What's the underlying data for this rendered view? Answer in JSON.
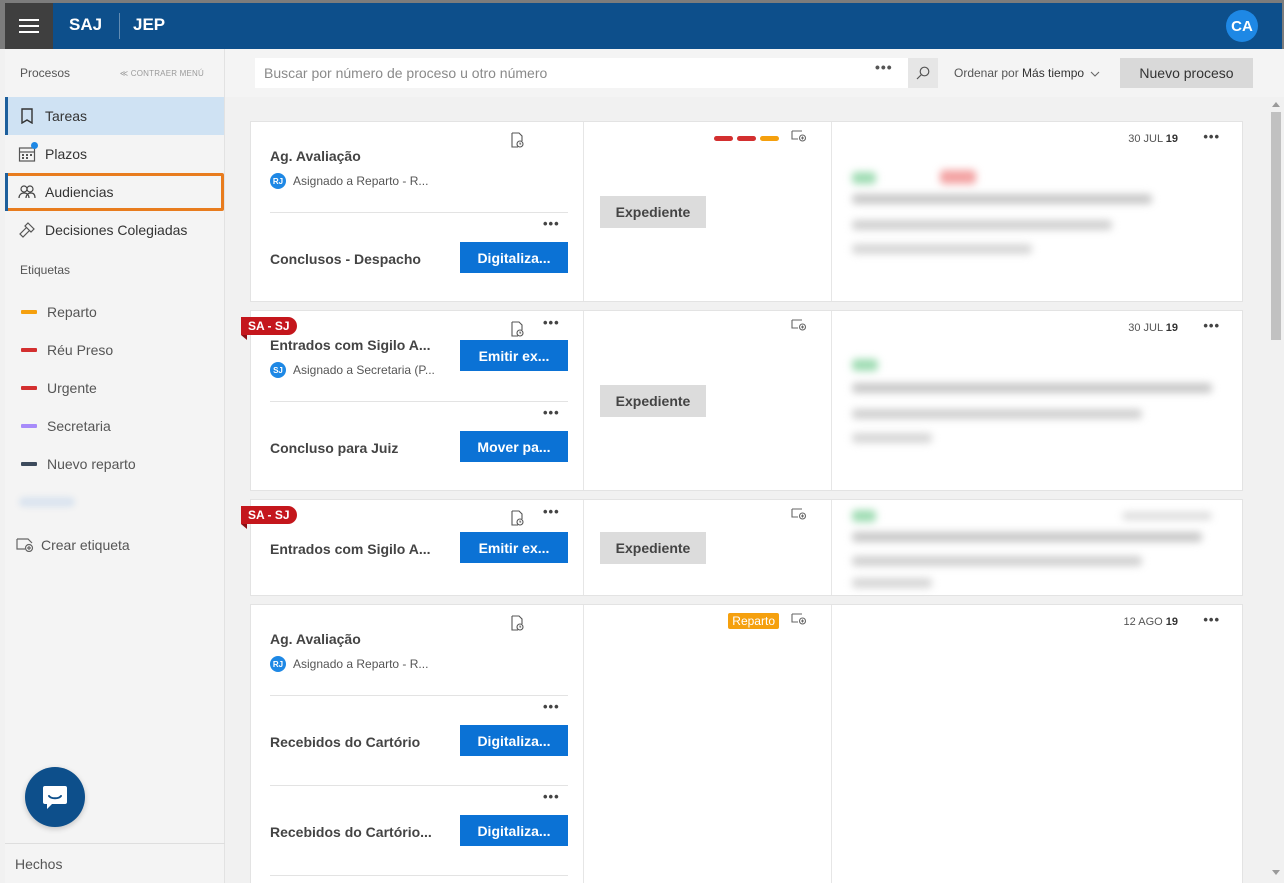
{
  "topbar": {
    "app1": "SAJ",
    "app2": "JEP",
    "avatar": "CA"
  },
  "sidebar": {
    "header_title": "Procesos",
    "collapse": "≪ CONTRAER MENÚ",
    "nav": [
      {
        "label": "Tareas",
        "icon": "bookmark-icon"
      },
      {
        "label": "Plazos",
        "icon": "calendar-icon"
      },
      {
        "label": "Audiencias",
        "icon": "people-icon"
      },
      {
        "label": "Decisiones Colegiadas",
        "icon": "gavel-icon"
      }
    ],
    "tags_title": "Etiquetas",
    "tags": [
      {
        "label": "Reparto",
        "color": "#f5a00e"
      },
      {
        "label": "Réu Preso",
        "color": "#d32f2f"
      },
      {
        "label": "Urgente",
        "color": "#d32f2f"
      },
      {
        "label": "Secretaria",
        "color": "#a78bfa"
      },
      {
        "label": "Nuevo reparto",
        "color": "#3c4a5c"
      }
    ],
    "create_tag": "Crear etiqueta",
    "footer": "Hechos"
  },
  "search": {
    "placeholder": "Buscar por número de proceso u otro número",
    "more": "•••",
    "sort_prefix": "Ordenar por",
    "sort_value": "Más tiempo",
    "new_process": "Nuevo proceso"
  },
  "cards": [
    {
      "task1_title": "Ag. Avaliação",
      "assign_initials": "RJ",
      "assign_text": "Asignado a Reparto - R...",
      "task2_title": "Conclusos - Despacho",
      "task2_button": "Digitaliza...",
      "expediente": "Expediente",
      "date_day": "30 JUL",
      "date_year": "19",
      "tag_colors": [
        "#d32f2f",
        "#d32f2f",
        "#f5a00e"
      ]
    },
    {
      "sa_tag": "SA - SJ",
      "task1_title": "Entrados com Sigilo A...",
      "task1_button": "Emitir ex...",
      "assign_initials": "SJ",
      "assign_text": "Asignado a Secretaria (P...",
      "task2_title": "Concluso para Juiz",
      "task2_button": "Mover pa...",
      "expediente": "Expediente",
      "date_day": "30 JUL",
      "date_year": "19"
    },
    {
      "sa_tag": "SA - SJ",
      "task1_title": "Entrados com Sigilo A...",
      "task1_button": "Emitir ex...",
      "expediente": "Expediente"
    },
    {
      "task1_title": "Ag. Avaliação",
      "assign_initials": "RJ",
      "assign_text": "Asignado a Reparto - R...",
      "task2_title": "Recebidos do Cartório",
      "task2_button": "Digitaliza...",
      "task3_title": "Recebidos do Cartório...",
      "task3_button": "Digitaliza...",
      "badge": "Reparto",
      "date_day": "12 AGO",
      "date_year": "19"
    }
  ],
  "dots": "•••"
}
